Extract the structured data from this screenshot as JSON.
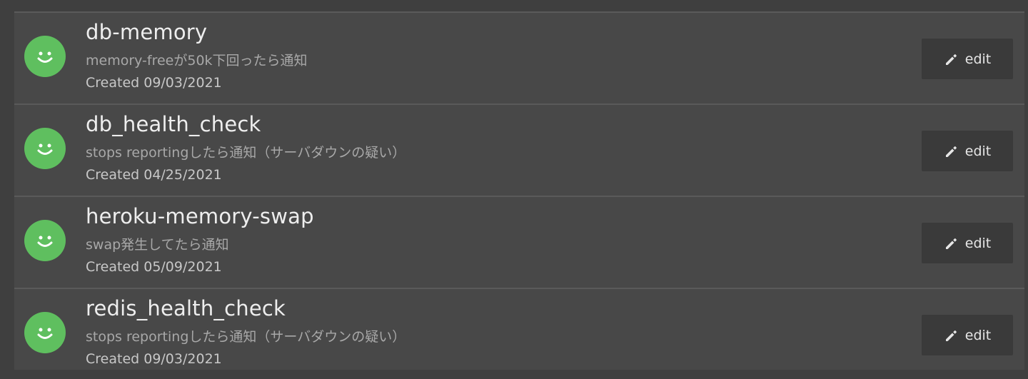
{
  "alerts": [
    {
      "name": "db-memory",
      "description": "memory-freeが50k下回ったら通知",
      "created": "Created 09/03/2021",
      "status_icon": "smiley-icon",
      "edit_label": "edit"
    },
    {
      "name": "db_health_check",
      "description": "stops reportingしたら通知（サーバダウンの疑い）",
      "created": "Created 04/25/2021",
      "status_icon": "smiley-icon",
      "edit_label": "edit"
    },
    {
      "name": "heroku-memory-swap",
      "description": "swap発生してたら通知",
      "created": "Created 05/09/2021",
      "status_icon": "smiley-icon",
      "edit_label": "edit"
    },
    {
      "name": "redis_health_check",
      "description": "stops reportingしたら通知（サーバダウンの疑い）",
      "created": "Created 09/03/2021",
      "status_icon": "smiley-icon",
      "edit_label": "edit"
    }
  ],
  "colors": {
    "background": "#3f3f3f",
    "row_background": "#484848",
    "status_ok": "#5fbf5f",
    "button_background": "#3a3a3a"
  },
  "edit_icon": "pencil-icon"
}
